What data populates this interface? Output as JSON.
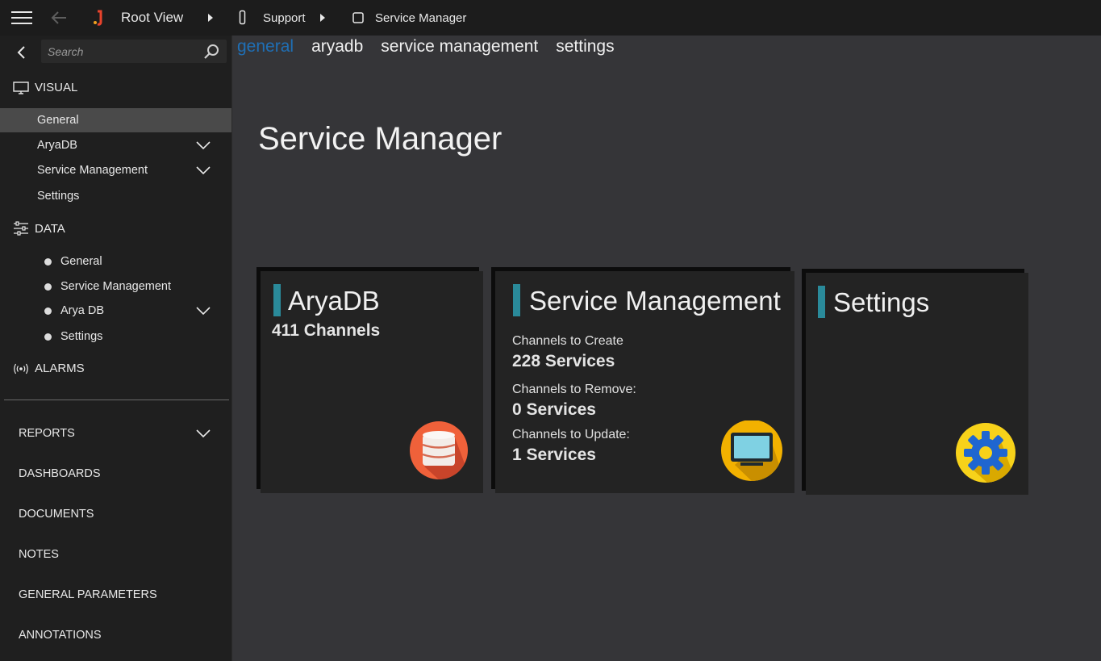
{
  "topbar": {
    "breadcrumbs": [
      "Root View",
      "Support",
      "Service Manager"
    ]
  },
  "sidebar": {
    "search_placeholder": "Search",
    "visual": {
      "label": "VISUAL",
      "items": [
        {
          "label": "General",
          "active": true
        },
        {
          "label": "AryaDB",
          "expandable": true
        },
        {
          "label": "Service Management",
          "expandable": true
        },
        {
          "label": "Settings"
        }
      ]
    },
    "data": {
      "label": "DATA",
      "items": [
        {
          "label": "General"
        },
        {
          "label": "Service Management"
        },
        {
          "label": "Arya DB",
          "expandable": true
        },
        {
          "label": "Settings"
        }
      ]
    },
    "alarms_label": "ALARMS",
    "bottom_items": [
      {
        "label": "REPORTS",
        "expandable": true
      },
      {
        "label": "DASHBOARDS"
      },
      {
        "label": "DOCUMENTS"
      },
      {
        "label": "NOTES"
      },
      {
        "label": "GENERAL PARAMETERS"
      },
      {
        "label": "ANNOTATIONS"
      }
    ]
  },
  "main": {
    "tabs": [
      {
        "label": "general",
        "active": true
      },
      {
        "label": "aryadb"
      },
      {
        "label": "service management"
      },
      {
        "label": "settings"
      }
    ],
    "title": "Service Manager",
    "cards": {
      "aryadb": {
        "title": "AryaDB",
        "value": "411 Channels",
        "icon": "database-icon"
      },
      "service_management": {
        "title": "Service Management",
        "create_label": "Channels to Create",
        "create_value": "228 Services",
        "remove_label": "Channels to Remove:",
        "remove_value": "0 Services",
        "update_label": "Channels to Update:",
        "update_value": "1 Services",
        "icon": "monitor-icon"
      },
      "settings": {
        "title": "Settings",
        "icon": "gear-icon"
      }
    }
  },
  "colors": {
    "active_tab": "#1f6fb5",
    "card_accent": "#2a8a9a",
    "db_icon_bg": "#f0613a",
    "monitor_icon_bg": "#f2b100",
    "gear_icon_bg": "#f7d21a",
    "gear_color": "#1f66d0"
  }
}
